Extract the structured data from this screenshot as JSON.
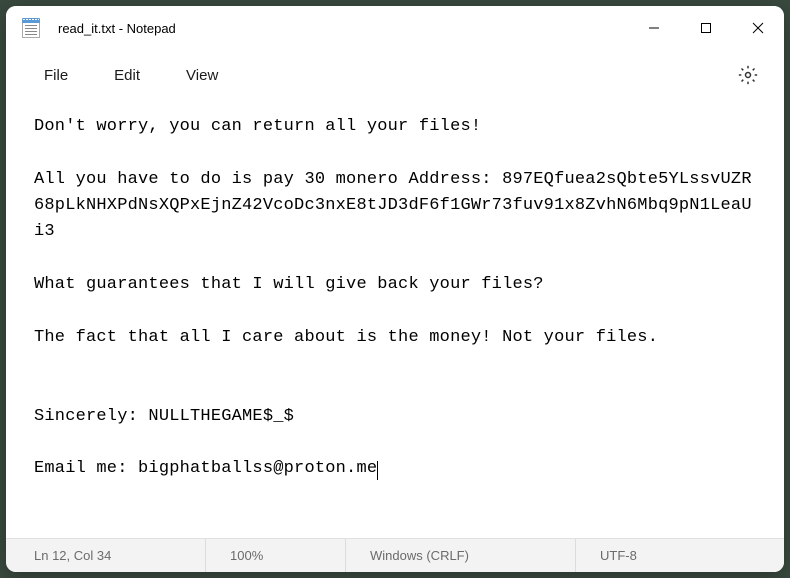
{
  "title": "read_it.txt - Notepad",
  "menu": {
    "file": "File",
    "edit": "Edit",
    "view": "View"
  },
  "content": {
    "line1": "Don't worry, you can return all your files!",
    "line2": "",
    "line3": "All you have to do is pay 30 monero Address: 897EQfuea2sQbte5YLssvUZR68pLkNHXPdNsXQPxEjnZ42VcoDc3nxE8tJD3dF6f1GWr73fuv91x8ZvhN6Mbq9pN1LeaUi3",
    "line4": "",
    "line5": "What guarantees that I will give back your files?",
    "line6": "",
    "line7": "The fact that all I care about is the money! Not your files.",
    "line8": "",
    "line9": "",
    "line10": "Sincerely: NULLTHEGAME$_$",
    "line11": "",
    "line12": "Email me: bigphatballss@proton.me"
  },
  "status": {
    "position": "Ln 12, Col 34",
    "zoom": "100%",
    "line_ending": "Windows (CRLF)",
    "encoding": "UTF-8"
  }
}
